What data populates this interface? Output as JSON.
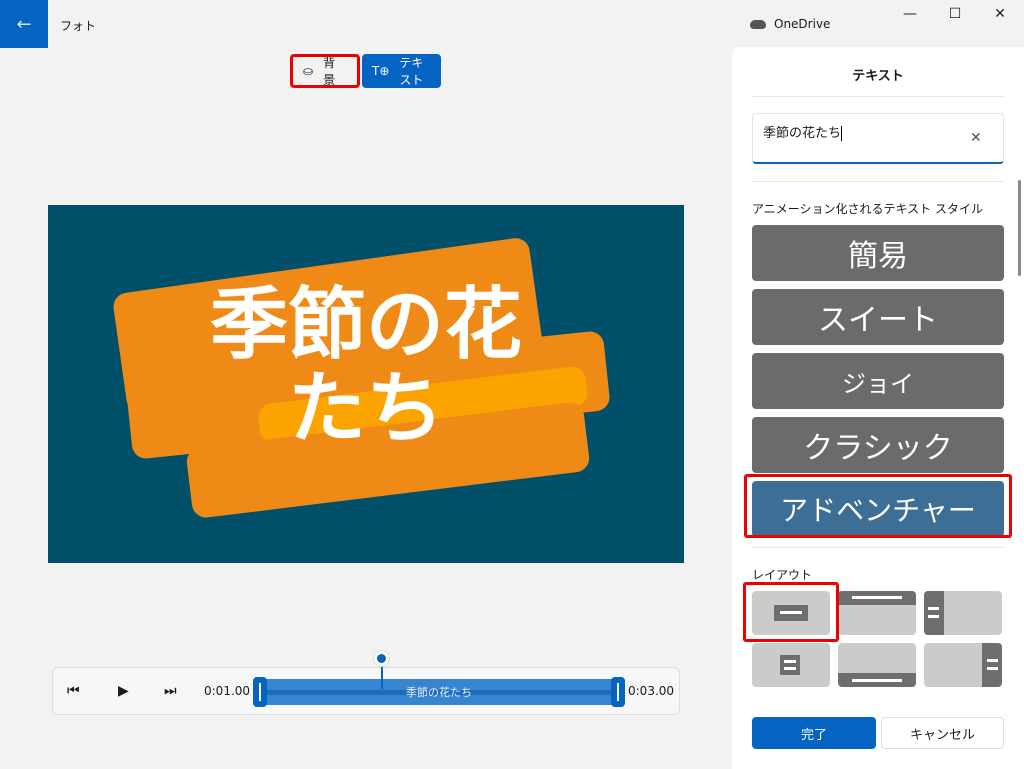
{
  "app": {
    "title": "フォト",
    "back_icon": "←",
    "onedrive": "OneDrive"
  },
  "window": {
    "minimize": "—",
    "maximize": "☐",
    "close": "✕"
  },
  "toolbar": {
    "background_label": "背景",
    "text_label": "テキスト"
  },
  "preview": {
    "text_line1": "季節の花",
    "text_line2": "たち",
    "bg_color": "#00506a",
    "accent": "#ef8a16"
  },
  "timeline": {
    "prev_icon": "⏮",
    "play_icon": "▶",
    "next_icon": "⏭",
    "start": "0:01.00",
    "end": "0:03.00",
    "clip_label": "季節の花たち"
  },
  "panel": {
    "title": "テキスト",
    "text_value": "季節の花たち",
    "clear_icon": "✕",
    "styles_label": "アニメーション化されるテキスト スタイル",
    "styles": [
      {
        "label": "簡易"
      },
      {
        "label": "スイート"
      },
      {
        "label": "ジョイ"
      },
      {
        "label": "クラシック"
      },
      {
        "label": "アドベンチャー",
        "selected": true
      }
    ],
    "layout_label": "レイアウト",
    "done": "完了",
    "cancel": "キャンセル"
  }
}
